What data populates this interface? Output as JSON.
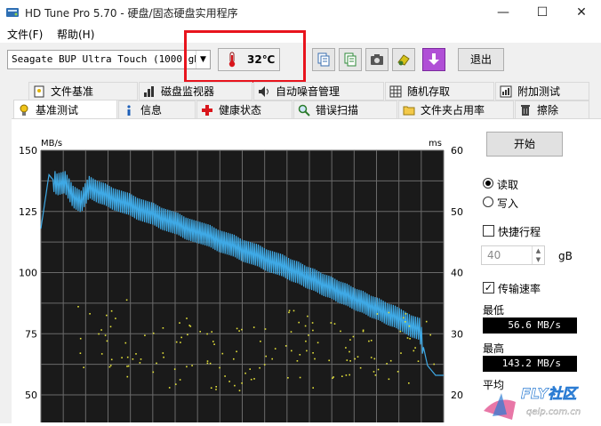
{
  "window": {
    "title": "HD Tune Pro 5.70 - 硬盘/固态硬盘实用程序",
    "minimize": "—",
    "maximize": "☐",
    "close": "✕"
  },
  "menu": {
    "file": "文件(F)",
    "help": "帮助(H)"
  },
  "toolbar": {
    "drive": "Seagate BUP Ultra Touch (1000 gB)",
    "temperature": "32℃",
    "exit": "退出"
  },
  "tabs_top": [
    "文件基准",
    "磁盘监视器",
    "自动噪音管理",
    "随机存取",
    "附加测试"
  ],
  "tabs_bottom": [
    "基准测试",
    "信息",
    "健康状态",
    "错误扫描",
    "文件夹占用率",
    "擦除"
  ],
  "controls": {
    "start": "开始",
    "read": "读取",
    "write": "写入",
    "short_stroke": "快捷行程",
    "short_stroke_value": "40",
    "short_stroke_unit": "gB",
    "transfer_rate": "传输速率",
    "min_label": "最低",
    "min_value": "56.6 MB/s",
    "max_label": "最高",
    "max_value": "143.2 MB/s",
    "avg_label": "平均"
  },
  "watermark": {
    "brand": "FLY社区",
    "url": "qeip.com.cn"
  },
  "chart_data": {
    "type": "line",
    "y_label_left": "MB/s",
    "y_label_right": "ms",
    "y_left_ticks": [
      150,
      125,
      100,
      75,
      50
    ],
    "y_right_ticks": [
      60,
      50,
      40,
      30,
      20
    ],
    "y_left_range": [
      50,
      150
    ],
    "y_right_range": [
      20,
      60
    ],
    "grid": true,
    "series": [
      {
        "color": "#3fa9e5",
        "x": [
          0,
          2,
          4,
          6,
          8,
          10,
          12,
          14,
          16,
          18,
          20,
          22,
          24,
          26,
          28,
          30,
          32,
          34,
          36,
          38,
          40,
          42,
          44,
          46,
          48,
          50,
          52,
          54,
          56,
          58,
          60,
          62,
          64,
          66,
          68,
          70,
          72,
          74,
          76,
          78,
          80,
          82,
          84,
          86,
          88,
          90,
          92,
          94,
          96,
          98,
          100
        ],
        "values": [
          118,
          140,
          136,
          137,
          131,
          129,
          135,
          133,
          132,
          130,
          129,
          128,
          126,
          125,
          124,
          122,
          121,
          120,
          118,
          117,
          116,
          115,
          113,
          112,
          111,
          109,
          108,
          107,
          105,
          104,
          103,
          101,
          100,
          98,
          97,
          95,
          94,
          92,
          91,
          89,
          88,
          86,
          85,
          83,
          82,
          80,
          78,
          77,
          62,
          58,
          58
        ]
      }
    ],
    "access_points": [
      [
        15,
        30
      ],
      [
        22,
        28
      ],
      [
        31,
        27
      ],
      [
        40,
        26
      ],
      [
        48,
        27
      ],
      [
        55,
        26
      ],
      [
        62,
        28
      ],
      [
        70,
        27
      ],
      [
        78,
        29
      ],
      [
        85,
        28
      ],
      [
        92,
        27
      ]
    ]
  }
}
